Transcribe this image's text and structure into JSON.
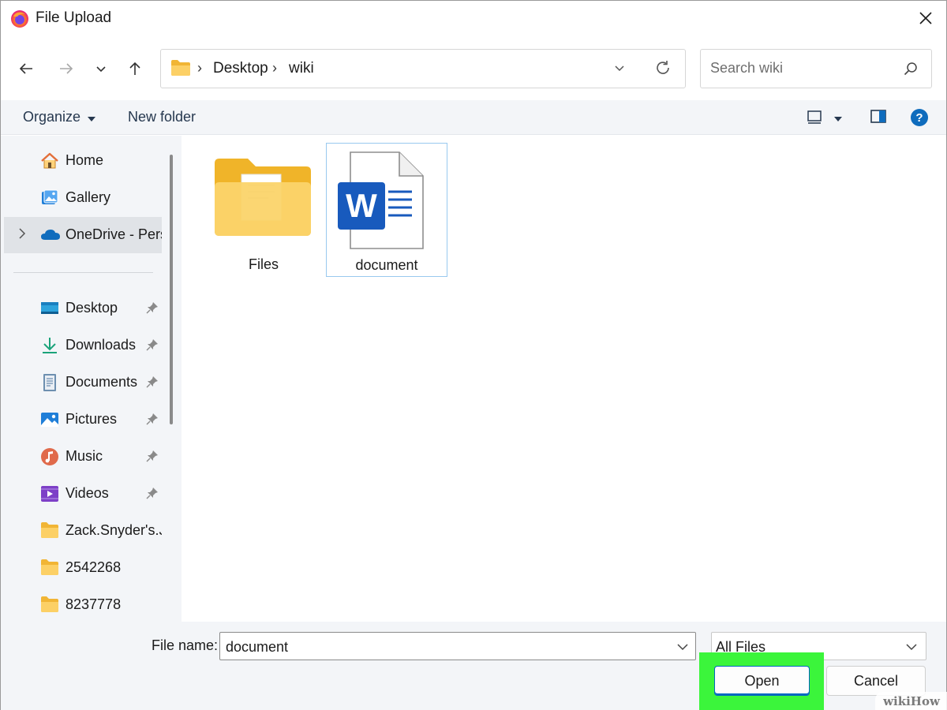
{
  "window": {
    "title": "File Upload"
  },
  "address": {
    "crumbs": [
      "Desktop",
      "wiki"
    ]
  },
  "search": {
    "placeholder": "Search wiki"
  },
  "command_bar": {
    "organize_label": "Organize",
    "new_folder_label": "New folder"
  },
  "sidebar": {
    "top_items": [
      {
        "label": "Home",
        "icon": "home-icon"
      },
      {
        "label": "Gallery",
        "icon": "gallery-icon"
      },
      {
        "label": "OneDrive - Personal",
        "icon": "onedrive-icon"
      }
    ],
    "quick_access": [
      {
        "label": "Desktop",
        "icon": "desktop-icon",
        "pinned": true
      },
      {
        "label": "Downloads",
        "icon": "download-icon",
        "pinned": true
      },
      {
        "label": "Documents",
        "icon": "documents-icon",
        "pinned": true
      },
      {
        "label": "Pictures",
        "icon": "pictures-icon",
        "pinned": true
      },
      {
        "label": "Music",
        "icon": "music-icon",
        "pinned": true
      },
      {
        "label": "Videos",
        "icon": "videos-icon",
        "pinned": true
      },
      {
        "label": "Zack.Snyder's.Justice.League",
        "icon": "folder-icon",
        "pinned": false
      },
      {
        "label": "2542268",
        "icon": "folder-icon",
        "pinned": false
      },
      {
        "label": "8237778",
        "icon": "folder-icon",
        "pinned": false
      }
    ]
  },
  "content": {
    "items": [
      {
        "label": "Files",
        "type": "folder"
      },
      {
        "label": "document",
        "type": "word-document",
        "selected": true
      }
    ]
  },
  "footer": {
    "file_name_label": "File name:",
    "file_name_value": "document",
    "file_type_value": "All Files",
    "open_label": "Open",
    "cancel_label": "Cancel"
  },
  "watermark": "wikiHow",
  "colors": {
    "accent": "#0067c0",
    "highlight": "#3bf53b",
    "folder": "#f8c644",
    "word_blue": "#185abd"
  }
}
